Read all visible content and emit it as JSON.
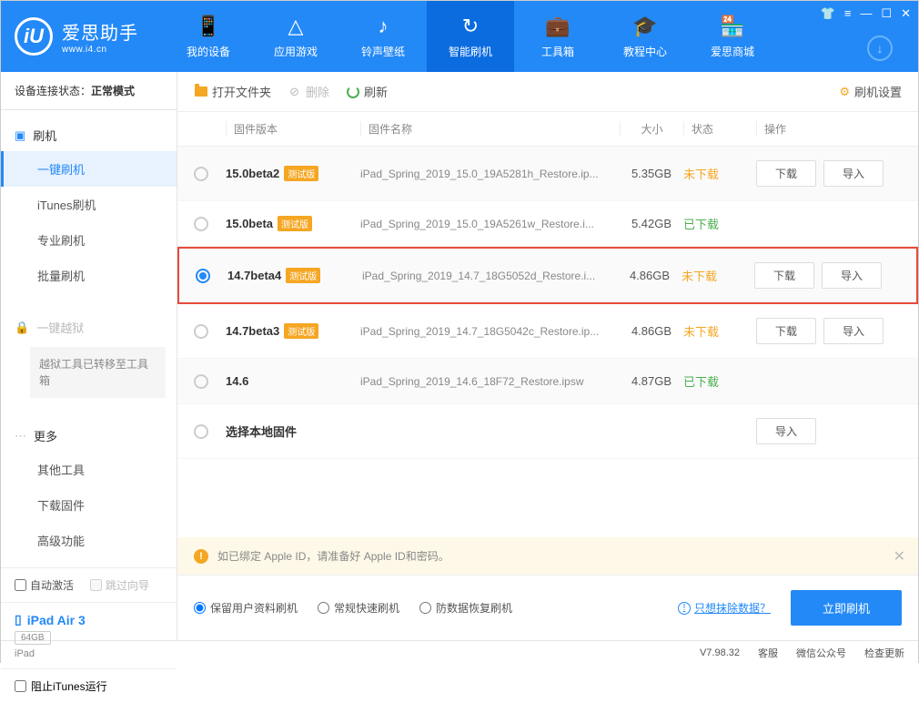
{
  "app": {
    "name": "爱思助手",
    "url": "www.i4.cn",
    "logo_letter": "iU"
  },
  "nav": [
    {
      "label": "我的设备",
      "icon": "📱"
    },
    {
      "label": "应用游戏",
      "icon": "△"
    },
    {
      "label": "铃声壁纸",
      "icon": "♪"
    },
    {
      "label": "智能刷机",
      "icon": "↻",
      "active": true
    },
    {
      "label": "工具箱",
      "icon": "💼"
    },
    {
      "label": "教程中心",
      "icon": "🎓"
    },
    {
      "label": "爱思商城",
      "icon": "🏪"
    }
  ],
  "sidebar": {
    "status_label": "设备连接状态：",
    "status_value": "正常模式",
    "flash_section": "刷机",
    "items_flash": [
      "一键刷机",
      "iTunes刷机",
      "专业刷机",
      "批量刷机"
    ],
    "jailbreak_section": "一键越狱",
    "jailbreak_note": "越狱工具已转移至工具箱",
    "more_section": "更多",
    "items_more": [
      "其他工具",
      "下载固件",
      "高级功能"
    ],
    "auto_activate": "自动激活",
    "skip_guide": "跳过向导",
    "device_name": "iPad Air 3",
    "device_storage": "64GB",
    "device_type": "iPad",
    "block_itunes": "阻止iTunes运行"
  },
  "toolbar": {
    "open_folder": "打开文件夹",
    "delete": "删除",
    "refresh": "刷新",
    "settings": "刷机设置"
  },
  "table": {
    "headers": {
      "version": "固件版本",
      "name": "固件名称",
      "size": "大小",
      "status": "状态",
      "action": "操作"
    },
    "rows": [
      {
        "version": "15.0beta2",
        "beta": "测试版",
        "name": "iPad_Spring_2019_15.0_19A5281h_Restore.ip...",
        "size": "5.35GB",
        "status": "未下载",
        "status_color": "orange",
        "download": true,
        "import": true
      },
      {
        "version": "15.0beta",
        "beta": "测试版",
        "name": "iPad_Spring_2019_15.0_19A5261w_Restore.i...",
        "size": "5.42GB",
        "status": "已下载",
        "status_color": "green"
      },
      {
        "version": "14.7beta4",
        "beta": "测试版",
        "name": "iPad_Spring_2019_14.7_18G5052d_Restore.i...",
        "size": "4.86GB",
        "status": "未下载",
        "status_color": "orange",
        "download": true,
        "import": true,
        "selected": true,
        "highlighted": true
      },
      {
        "version": "14.7beta3",
        "beta": "测试版",
        "name": "iPad_Spring_2019_14.7_18G5042c_Restore.ip...",
        "size": "4.86GB",
        "status": "未下载",
        "status_color": "orange",
        "download": true,
        "import": true
      },
      {
        "version": "14.6",
        "name": "iPad_Spring_2019_14.6_18F72_Restore.ipsw",
        "size": "4.87GB",
        "status": "已下载",
        "status_color": "green"
      },
      {
        "version": "选择本地固件",
        "local": true,
        "import": true
      }
    ],
    "btn_download": "下载",
    "btn_import": "导入"
  },
  "warning": "如已绑定 Apple ID，请准备好 Apple ID和密码。",
  "flash_options": {
    "keep_data": "保留用户资料刷机",
    "quick": "常规快速刷机",
    "anti_recovery": "防数据恢复刷机",
    "erase_link": "只想抹除数据？",
    "flash_now": "立即刷机"
  },
  "statusbar": {
    "version": "V7.98.32",
    "kefu": "客服",
    "wechat": "微信公众号",
    "check_update": "检查更新"
  }
}
